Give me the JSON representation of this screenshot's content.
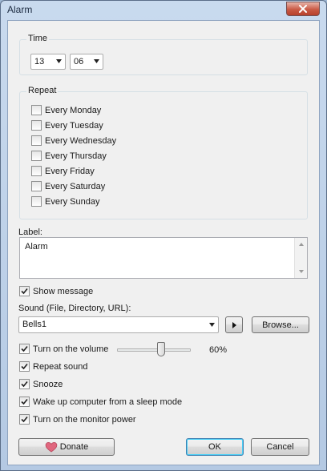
{
  "window": {
    "title": "Alarm"
  },
  "time": {
    "group_label": "Time",
    "hour": "13",
    "minute": "06"
  },
  "repeat": {
    "group_label": "Repeat",
    "days": [
      {
        "label": "Every Monday",
        "checked": false
      },
      {
        "label": "Every Tuesday",
        "checked": false
      },
      {
        "label": "Every Wednesday",
        "checked": false
      },
      {
        "label": "Every Thursday",
        "checked": false
      },
      {
        "label": "Every Friday",
        "checked": false
      },
      {
        "label": "Every Saturday",
        "checked": false
      },
      {
        "label": "Every Sunday",
        "checked": false
      }
    ]
  },
  "label_field": {
    "caption": "Label:",
    "value": "Alarm"
  },
  "show_message": {
    "label": "Show message",
    "checked": true
  },
  "sound": {
    "caption": "Sound (File, Directory, URL):",
    "value": "Bells1",
    "browse_label": "Browse..."
  },
  "volume": {
    "label": "Turn on the volume",
    "checked": true,
    "percent_text": "60%",
    "level": 0.6
  },
  "options": [
    {
      "label": "Repeat sound",
      "checked": true
    },
    {
      "label": "Snooze",
      "checked": true
    },
    {
      "label": "Wake up computer from a sleep mode",
      "checked": true
    },
    {
      "label": "Turn on the monitor power",
      "checked": true
    }
  ],
  "footer": {
    "donate_label": "Donate",
    "ok_label": "OK",
    "cancel_label": "Cancel"
  },
  "icons": {
    "close": "close-icon",
    "dropdown": "chevron-down-icon",
    "play": "play-icon",
    "heart": "heart-icon"
  },
  "colors": {
    "heart": "#e0677e",
    "close_button": "#c95a45",
    "default_button_border": "#3c7fb1"
  }
}
